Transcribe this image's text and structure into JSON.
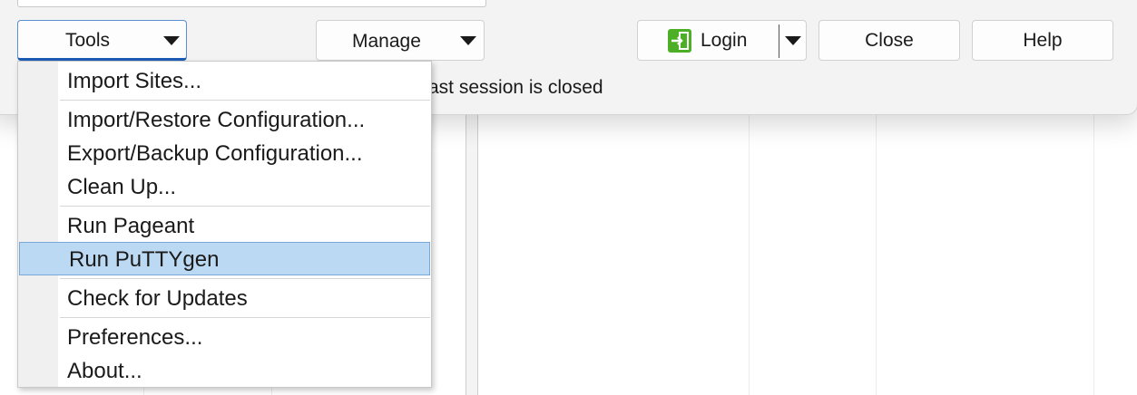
{
  "toolbar": {
    "tools_label": "Tools",
    "manage_label": "Manage",
    "login_label": "Login",
    "close_label": "Close",
    "help_label": "Help"
  },
  "status": {
    "text": "ast session is closed"
  },
  "tools_menu": {
    "items": [
      {
        "label": "Import Sites..."
      },
      {
        "label": "Import/Restore Configuration..."
      },
      {
        "label": "Export/Backup Configuration..."
      },
      {
        "label": "Clean Up..."
      },
      {
        "label": "Run Pageant"
      },
      {
        "label": "Run PuTTYgen"
      },
      {
        "label": "Check for Updates"
      },
      {
        "label": "Preferences..."
      },
      {
        "label": "About..."
      }
    ],
    "highlighted": "Run PuTTYgen"
  },
  "colors": {
    "highlight_bg": "#bcd9f3",
    "login_icon": "#4caf25",
    "focus_border": "#1c5cb5"
  },
  "icons": {
    "login": "login-arrow-icon",
    "dropdown": "chevron-down-icon"
  }
}
